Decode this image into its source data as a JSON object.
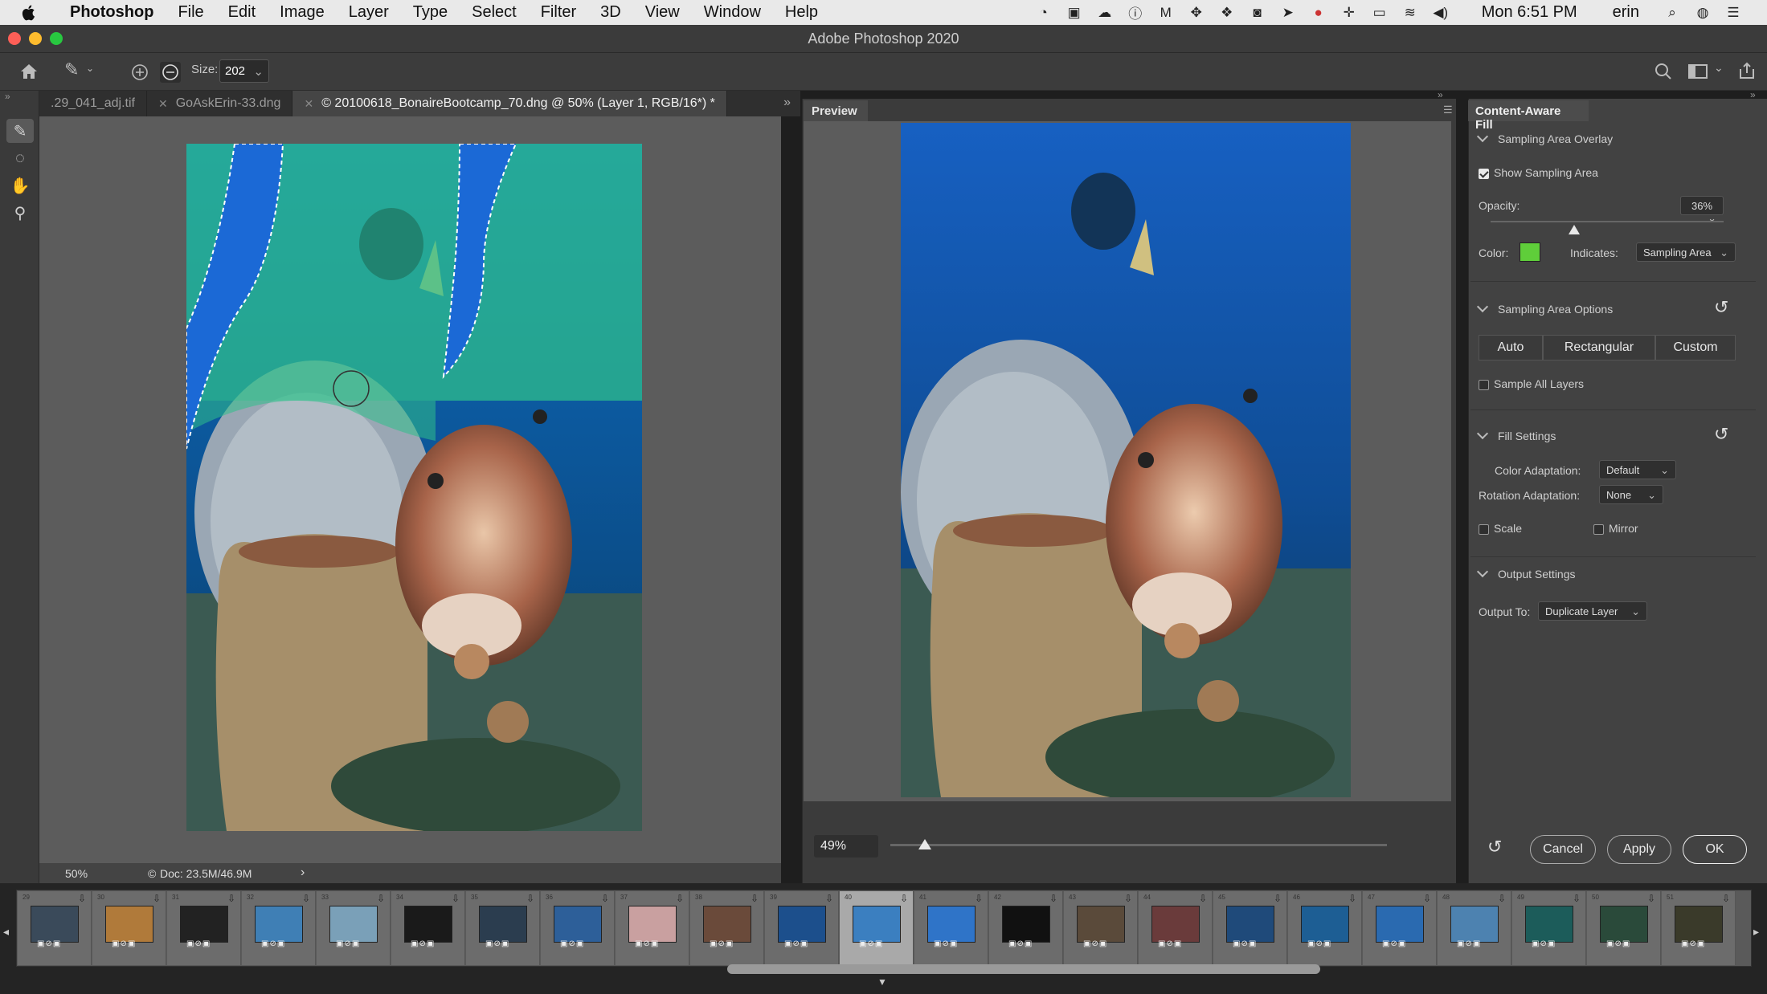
{
  "menubar": {
    "app": "Photoshop",
    "menus": [
      "File",
      "Edit",
      "Image",
      "Layer",
      "Type",
      "Select",
      "Filter",
      "3D",
      "View",
      "Window",
      "Help"
    ],
    "clock": "Mon 6:51 PM",
    "user": "erin"
  },
  "window": {
    "title": "Adobe Photoshop 2020"
  },
  "options": {
    "size_label": "Size:",
    "size_value": "202"
  },
  "tabs": [
    {
      "label": ".29_041_adj.tif",
      "active": false
    },
    {
      "label": "GoAskErin-33.dng",
      "active": false
    },
    {
      "label": "© 20100618_BonaireBootcamp_70.dng @ 50% (Layer 1, RGB/16*) *",
      "active": true
    }
  ],
  "status": {
    "zoom": "50%",
    "doc": "Doc: 23.5M/46.9M"
  },
  "preview": {
    "title": "Preview",
    "zoom": "49%",
    "zoom_fraction": 0.07
  },
  "panel": {
    "title": "Content-Aware Fill",
    "sampling_overlay": {
      "header": "Sampling Area Overlay",
      "show_label": "Show Sampling Area",
      "show_checked": true,
      "opacity_label": "Opacity:",
      "opacity_value": "36%",
      "opacity_fraction": 0.36,
      "color_label": "Color:",
      "color_value": "#5fce3a",
      "indicates_label": "Indicates:",
      "indicates_value": "Sampling Area"
    },
    "sampling_options": {
      "header": "Sampling Area Options",
      "buttons": [
        "Auto",
        "Rectangular",
        "Custom"
      ],
      "all_layers_label": "Sample All Layers"
    },
    "fill_settings": {
      "header": "Fill Settings",
      "color_adapt_label": "Color Adaptation:",
      "color_adapt_value": "Default",
      "rotation_label": "Rotation Adaptation:",
      "rotation_value": "None",
      "scale_label": "Scale",
      "mirror_label": "Mirror"
    },
    "output": {
      "header": "Output Settings",
      "output_label": "Output To:",
      "output_value": "Duplicate Layer"
    },
    "buttons": {
      "cancel": "Cancel",
      "apply": "Apply",
      "ok": "OK"
    }
  },
  "filmstrip": {
    "numbers": [
      "29",
      "30",
      "31",
      "32",
      "33",
      "34",
      "35",
      "36",
      "37",
      "38",
      "39",
      "40",
      "41",
      "42",
      "43",
      "44",
      "45",
      "46",
      "47",
      "48",
      "49",
      "50",
      "51"
    ]
  },
  "colors": {
    "accent": "#5fce3a",
    "ui_bg": "#3b3b3b",
    "canvas": "#5c5c5c"
  }
}
